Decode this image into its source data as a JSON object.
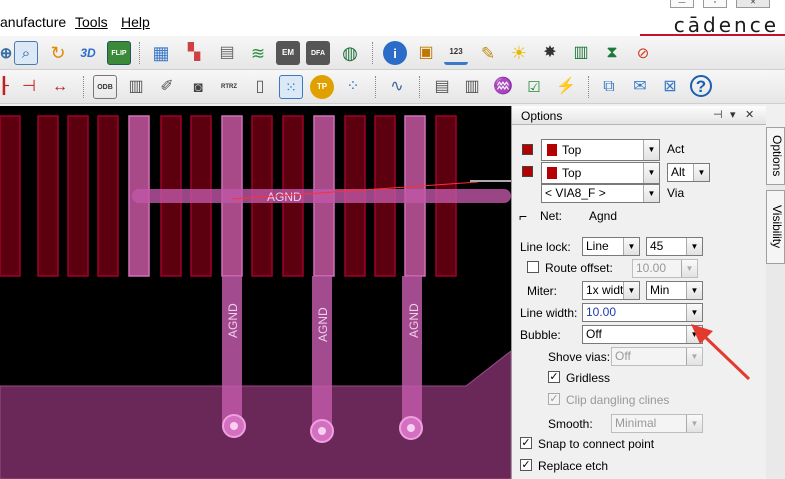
{
  "menu": {
    "items": [
      "anufacture",
      "Tools",
      "Help"
    ]
  },
  "brand": {
    "logo": "cādence",
    "accent_color": "#c8102e"
  },
  "window_controls": [
    "minimize",
    "restore",
    "close"
  ],
  "toolbar_row1": {
    "icons": [
      "zoom-fit-icon",
      "zoom-icon",
      "refresh-icon",
      "view-3d-icon",
      "flip-icon",
      "grid-icon",
      "colors-icon",
      "layers-icon",
      "stack-icon",
      "em-icon",
      "dfa-icon",
      "globe-icon",
      "info-icon",
      "show-element-icon",
      "measure-icon",
      "brush-icon",
      "highlight-icon",
      "dehighlight-icon",
      "bars-icon",
      "hourglass-icon",
      "delete-icon"
    ],
    "labels": {
      "view_3d": "3D",
      "flip": "FLIP",
      "em": "EM",
      "dfa": "DFA",
      "measure": "123"
    }
  },
  "toolbar_row2": {
    "icons": [
      "net-pin-icon",
      "dimension-icon",
      "odb-icon",
      "library-icon",
      "edit-icon",
      "camera-icon",
      "rtrz-icon",
      "status-icon",
      "grid-points-icon",
      "testpoint-icon",
      "array-icon",
      "route-icon",
      "report-icon",
      "book-icon",
      "constraint-icon",
      "check-icon",
      "analyze-icon",
      "copy-icon",
      "envelope-icon",
      "message-icon",
      "help-icon"
    ],
    "labels": {
      "odb": "ODB",
      "rtrz": "RTRZ",
      "testpoint": "TP"
    }
  },
  "canvas": {
    "net_labels": [
      "AGND",
      "AGND",
      "AGND",
      "AGND"
    ],
    "colors": {
      "pad": "#6e0010",
      "highlight": "#e070c0",
      "plane": "#6a2858",
      "background": "#000000"
    }
  },
  "options_panel": {
    "title": "Options",
    "act_layer": {
      "value": "Top",
      "label": "Act"
    },
    "alt_layer": {
      "value": "Top",
      "mode": "Alt",
      "label": "Via"
    },
    "via": {
      "value": "< VIA8_F >"
    },
    "net": {
      "label": "Net:",
      "value": "Agnd"
    },
    "line_lock": {
      "label": "Line lock:",
      "mode": "Line",
      "angle": "45"
    },
    "route_offset": {
      "label": "Route offset:",
      "value": "10.00",
      "checked": false
    },
    "miter": {
      "label": "Miter:",
      "mode": "1x width",
      "extent": "Min"
    },
    "line_width": {
      "label": "Line width:",
      "value": "10.00"
    },
    "bubble": {
      "label": "Bubble:",
      "value": "Off"
    },
    "shove_vias": {
      "label": "Shove vias:",
      "value": "Off"
    },
    "gridless": {
      "label": "Gridless",
      "checked": true
    },
    "clip_dangling": {
      "label": "Clip dangling clines",
      "checked": true
    },
    "smooth": {
      "label": "Smooth:",
      "value": "Minimal"
    },
    "snap": {
      "label": "Snap to connect point",
      "checked": true
    },
    "replace_etch": {
      "label": "Replace etch",
      "checked": true
    }
  },
  "side_tabs": [
    "Options",
    "Visibility"
  ],
  "annotation_color": "#e23b2e"
}
